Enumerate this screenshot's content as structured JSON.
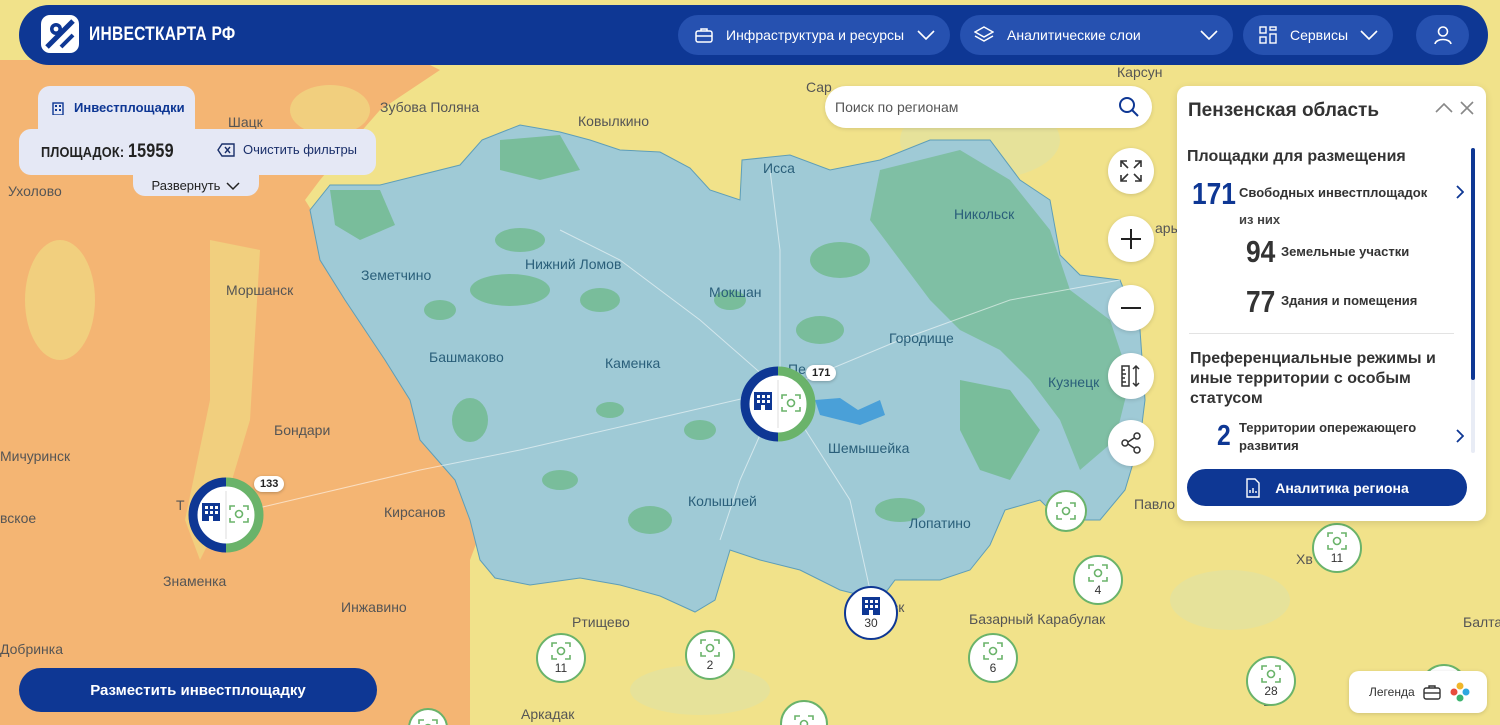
{
  "header": {
    "logo_text": "ИНВЕСТКАРТА РФ",
    "nav": [
      {
        "label": "Инфраструктура и ресурсы",
        "icon": "briefcase-icon"
      },
      {
        "label": "Аналитические слои",
        "icon": "layers-icon"
      },
      {
        "label": "Сервисы",
        "icon": "grid-icon"
      }
    ],
    "user_icon": "user-icon"
  },
  "filters": {
    "tab_label": "Инвестплощадки",
    "count_label": "ПЛОЩАДОК:",
    "count_value": "15959",
    "clear_label": "Очистить фильтры",
    "expand_label": "Развернуть"
  },
  "search": {
    "placeholder": "Поиск по регионам"
  },
  "panel": {
    "title": "Пензенская область",
    "section1_title": "Площадки для размещения",
    "free_count": "171",
    "free_label": "Свободных инвестплощадок",
    "of_them": "из них",
    "land_count": "94",
    "land_label": "Земельные участки",
    "buildings_count": "77",
    "buildings_label": "Здания и помещения",
    "section2_title": "Преференциальные режимы и иные территории с особым статусом",
    "tor_count": "2",
    "tor_label": "Территории опережающего развития",
    "analytics_button": "Аналитика региона"
  },
  "bottom": {
    "place_button": "Разместить инвестплощадку",
    "legend_label": "Легенда"
  },
  "map": {
    "cities": [
      {
        "name": "Зубова Поляна"
      },
      {
        "name": "Ковылкино"
      },
      {
        "name": "Шацк"
      },
      {
        "name": "Ухолово"
      },
      {
        "name": "Карсун"
      },
      {
        "name": "Сар"
      },
      {
        "name": "Исса"
      },
      {
        "name": "Никольск"
      },
      {
        "name": "Земетчино"
      },
      {
        "name": "Нижний Ломов"
      },
      {
        "name": "Мокшан"
      },
      {
        "name": "Моршанск"
      },
      {
        "name": "Башмаково"
      },
      {
        "name": "Каменка"
      },
      {
        "name": "Городище"
      },
      {
        "name": "Кузнецк"
      },
      {
        "name": "Пе"
      },
      {
        "name": "Шемышейка"
      },
      {
        "name": "Бондари"
      },
      {
        "name": "Мичуринск"
      },
      {
        "name": "Колышлей"
      },
      {
        "name": "Т"
      },
      {
        "name": "вское"
      },
      {
        "name": "Кирсанов"
      },
      {
        "name": "Лопатино"
      },
      {
        "name": "Павло"
      },
      {
        "name": "Знаменка"
      },
      {
        "name": "Хв"
      },
      {
        "name": "Инжавино"
      },
      {
        "name": "Ртищево"
      },
      {
        "name": "Базарный Карабулак"
      },
      {
        "name": "Добринка"
      },
      {
        "name": "Аркадак"
      },
      {
        "name": "Балтай"
      },
      {
        "name": "ары"
      },
      {
        "name": "вск"
      },
      {
        "name": "Б"
      }
    ],
    "clusters_big": [
      {
        "count": "171"
      },
      {
        "count": "133"
      }
    ],
    "cluster_building_count": "30",
    "clusters_small": [
      "11",
      "4",
      "11",
      "2",
      "6",
      "28"
    ]
  },
  "colors": {
    "brand": "#0e3794",
    "region_fill": "#9fcad6",
    "forest": "#79bd9b",
    "map_yellow": "#f1e28a",
    "map_orange": "#f4b573",
    "cluster_green": "#6ab36a"
  }
}
